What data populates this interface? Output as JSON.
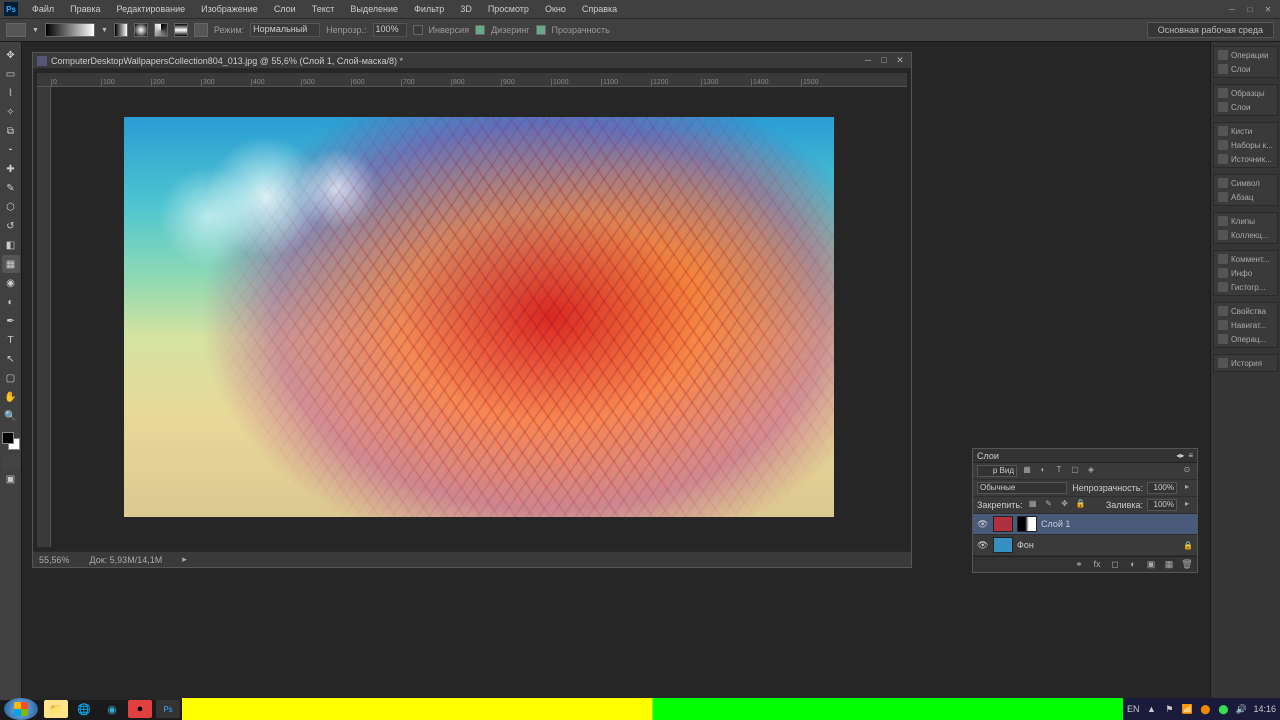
{
  "app": {
    "logo": "Ps"
  },
  "menu": {
    "items": [
      "Файл",
      "Правка",
      "Редактирование",
      "Изображение",
      "Слои",
      "Текст",
      "Выделение",
      "Фильтр",
      "3D",
      "Просмотр",
      "Окно",
      "Справка"
    ]
  },
  "options": {
    "mode_label": "Режим:",
    "mode_value": "Нормальный",
    "opacity_label": "Непрозр.:",
    "opacity_value": "100%",
    "reverse": "Инверсия",
    "dither": "Дизеринг",
    "transparency": "Прозрачность",
    "workspace_label": "Основная рабочая среда"
  },
  "document": {
    "title": "ComputerDesktopWallpapersCollection804_013.jpg @ 55,6% (Слой 1, Слой-маска/8) *",
    "zoom": "55,56%",
    "doc_info": "Док: 5,93M/14,1M",
    "ruler_ticks": [
      "0",
      "100",
      "200",
      "300",
      "400",
      "500",
      "600",
      "700",
      "800",
      "900",
      "1000",
      "1100",
      "1200",
      "1300",
      "1400",
      "1500"
    ]
  },
  "right_panels": {
    "groups": [
      {
        "items": [
          {
            "icon": "compass",
            "label": "Операции"
          },
          {
            "icon": "grid",
            "label": "Слои"
          }
        ]
      },
      {
        "items": [
          {
            "icon": "swatch",
            "label": "Образцы"
          },
          {
            "icon": "layers",
            "label": "Слои"
          }
        ]
      },
      {
        "items": [
          {
            "icon": "brush",
            "label": "Кисти"
          },
          {
            "icon": "presets",
            "label": "Наборы к..."
          },
          {
            "icon": "clone",
            "label": "Источник..."
          }
        ]
      },
      {
        "items": [
          {
            "icon": "char",
            "label": "Символ"
          },
          {
            "icon": "para",
            "label": "Абзац"
          }
        ]
      },
      {
        "items": [
          {
            "icon": "clip",
            "label": "Клипы"
          },
          {
            "icon": "clips",
            "label": "Коллекц..."
          }
        ]
      },
      {
        "items": [
          {
            "icon": "note",
            "label": "Коммент..."
          },
          {
            "icon": "info",
            "label": "Инфо"
          },
          {
            "icon": "hist",
            "label": "Гистогр..."
          }
        ]
      },
      {
        "items": [
          {
            "icon": "prop",
            "label": "Свойства"
          },
          {
            "icon": "nav",
            "label": "Навигат..."
          },
          {
            "icon": "op",
            "label": "Операц..."
          }
        ]
      },
      {
        "items": [
          {
            "icon": "history",
            "label": "История"
          }
        ]
      }
    ]
  },
  "layers_panel": {
    "title": "Слои",
    "kind_label": "р Вид",
    "blend_label": "Обычные",
    "opacity_label": "Непрозрачность:",
    "opacity_value": "100%",
    "lock_label": "Закрепить:",
    "fill_label": "Заливка:",
    "fill_value": "100%",
    "layers": [
      {
        "name": "Слой 1",
        "has_mask": true,
        "selected": true,
        "thumb_color": "#b03040"
      },
      {
        "name": "Фон",
        "locked": true,
        "thumb_color": "#3590c0"
      }
    ]
  },
  "taskbar": {
    "lang": "EN",
    "time": "14:16",
    "icons": [
      "folder",
      "browser",
      "media",
      "app1",
      "rec",
      "ps"
    ]
  },
  "tools": [
    "move",
    "marquee",
    "lasso",
    "wand",
    "crop",
    "eyedropper",
    "heal",
    "brush",
    "stamp",
    "history",
    "eraser",
    "gradient",
    "blur",
    "dodge",
    "pen",
    "type",
    "path",
    "shape",
    "hand",
    "zoom"
  ]
}
